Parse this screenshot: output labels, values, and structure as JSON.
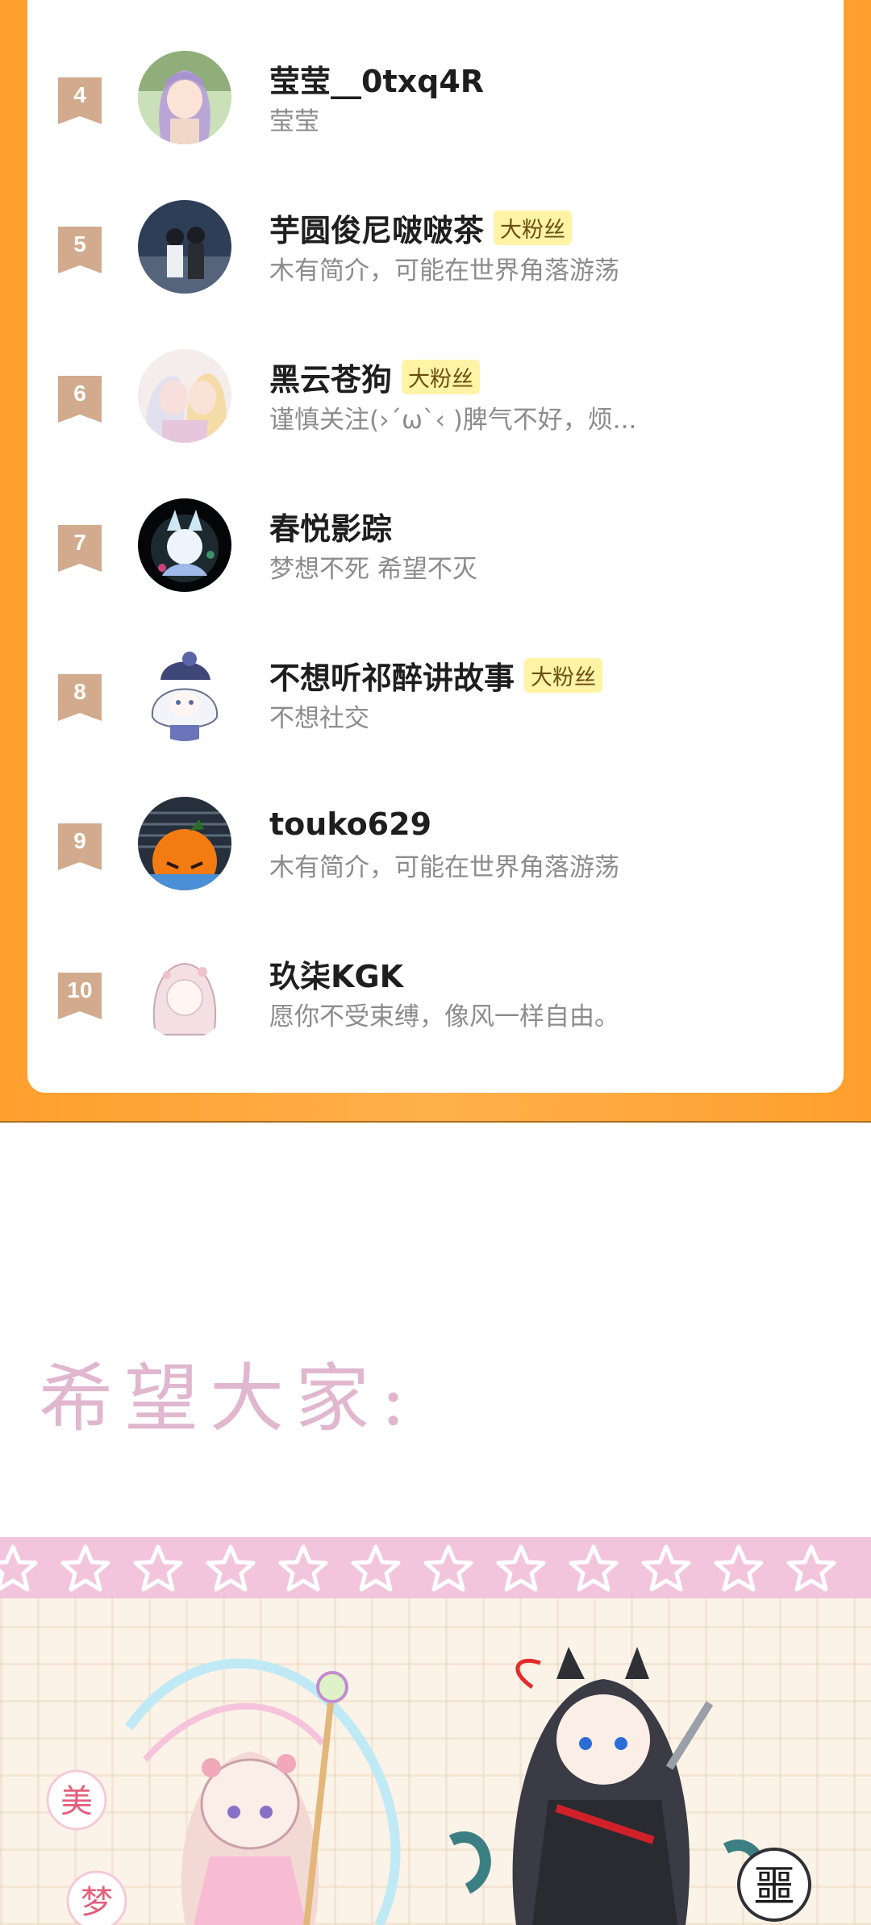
{
  "ranking": {
    "fan_badge_label": "大粉丝",
    "rows": [
      {
        "rank": "4",
        "name": "莹莹__0txq4R",
        "bio": "莹莹",
        "fan_badge": false,
        "avatar": "anime-girl-purple-hair-avatar"
      },
      {
        "rank": "5",
        "name": "芋圆俊尼啵啵茶",
        "bio": "木有简介，可能在世界角落游荡",
        "fan_badge": true,
        "avatar": "couple-night-sky-avatar"
      },
      {
        "rank": "6",
        "name": "黑云苍狗",
        "bio": "谨慎关注(›´ω`‹ )脾气不好，烦...",
        "fan_badge": true,
        "avatar": "anime-couple-kiss-avatar"
      },
      {
        "rank": "7",
        "name": "春悦影踪",
        "bio": "梦想不死 希望不灭",
        "fan_badge": false,
        "avatar": "fox-spirit-avatar"
      },
      {
        "rank": "8",
        "name": "不想听祁醉讲故事",
        "bio": "不想社交",
        "fan_badge": true,
        "avatar": "chibi-white-hair-avatar"
      },
      {
        "rank": "9",
        "name": "touko629",
        "bio": "木有简介，可能在世界角落游荡",
        "fan_badge": false,
        "avatar": "orange-fruit-avatar"
      },
      {
        "rank": "10",
        "name": "玖柒KGK",
        "bio": "愿你不受束缚，像风一样自由。",
        "fan_badge": false,
        "avatar": "sketch-girl-avatar"
      }
    ]
  },
  "message": {
    "hope_text": "希望大家:"
  },
  "illustration": {
    "left_chars": [
      "美",
      "梦"
    ],
    "right_char": "噩"
  },
  "colors": {
    "orange_bg": "#ff9f2e",
    "badge_color": "#d2aa8d",
    "fan_badge_bg": "#fff3a6",
    "hope_text": "#e0b7cf",
    "star_band": "#f2c5dd"
  }
}
